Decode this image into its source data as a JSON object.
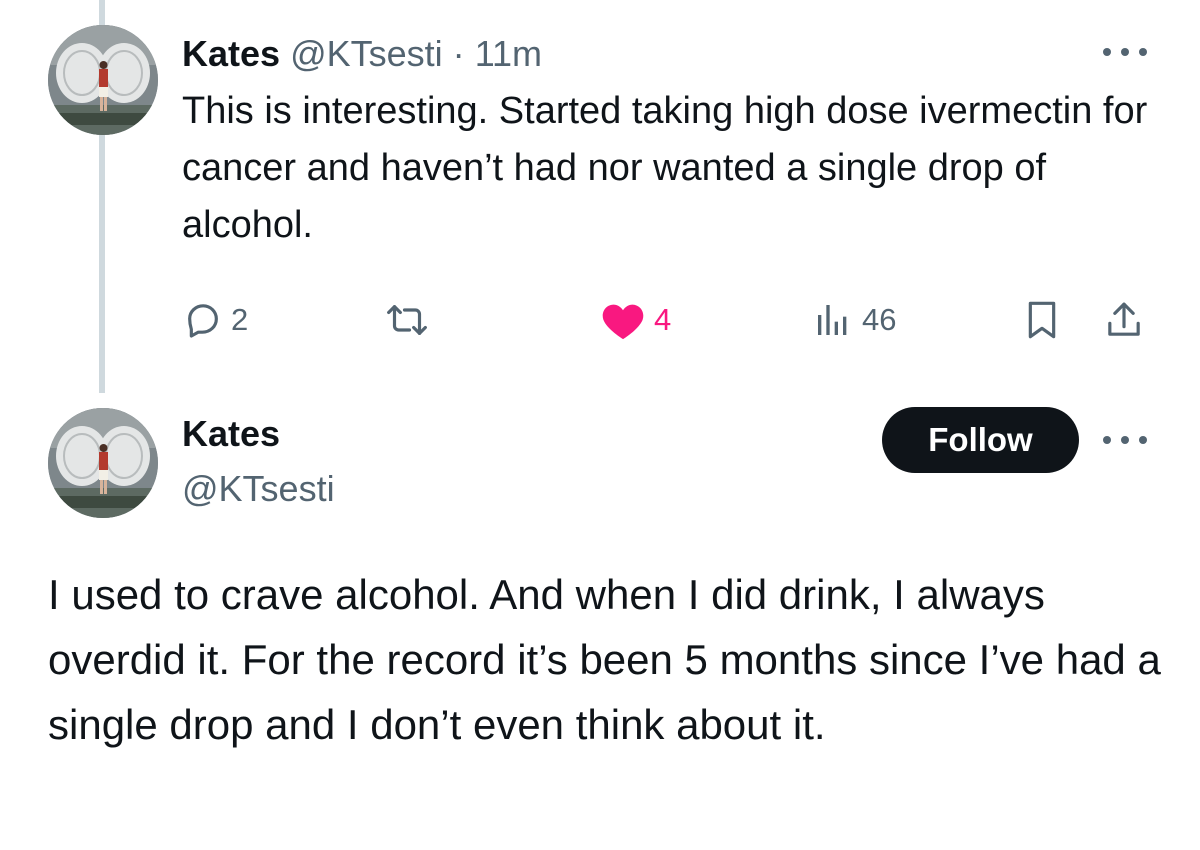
{
  "reply_tweet": {
    "author_name": "Kates",
    "author_handle": "@KTsesti",
    "separator": "·",
    "time": "11m",
    "text": "This is interesting. Started taking high dose ivermectin for cancer and haven’t had nor wanted a single drop of alcohol.",
    "actions": {
      "reply_count": "2",
      "retweet_count": "",
      "like_count": "4",
      "views_count": "46",
      "liked": true
    },
    "icons": [
      "reply-icon",
      "retweet-icon",
      "heart-icon",
      "views-icon",
      "bookmark-icon",
      "share-icon",
      "more-icon"
    ],
    "colors": {
      "like": "#f91880",
      "muted": "#536471"
    }
  },
  "main_tweet": {
    "author_name": "Kates",
    "author_handle": "@KTsesti",
    "follow_label": "Follow",
    "text": "I used to crave alcohol. And when I did drink, I always overdid it. For the record it’s been 5 months since I’ve had a single drop and I don’t even think about it.",
    "colors": {
      "follow_bg": "#0f1419",
      "follow_text": "#ffffff"
    }
  }
}
